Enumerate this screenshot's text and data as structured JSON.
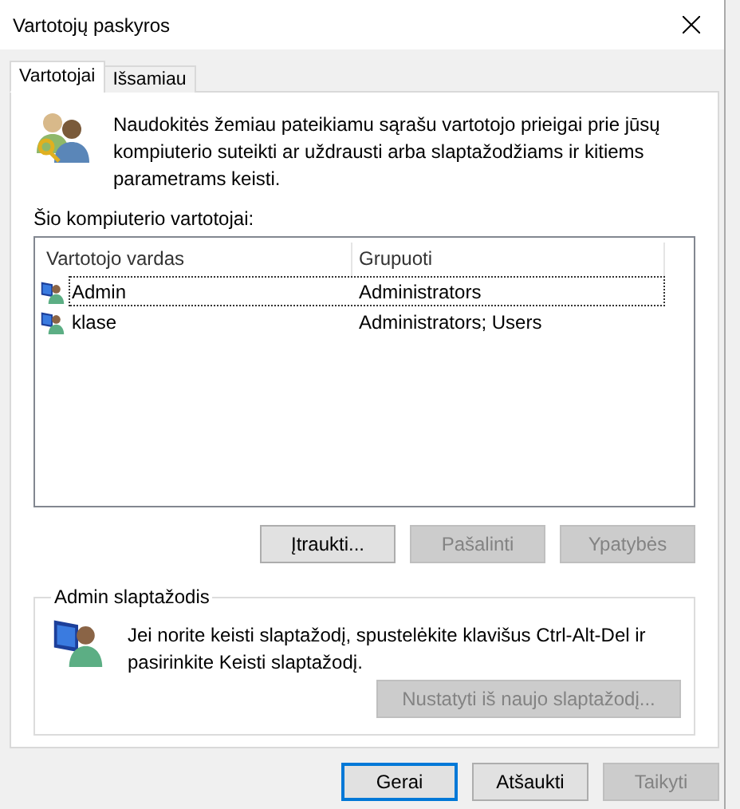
{
  "window": {
    "title": "Vartotojų paskyros"
  },
  "tabs": [
    {
      "label": "Vartotojai",
      "selected": true
    },
    {
      "label": "Išsamiau",
      "selected": false
    }
  ],
  "intro": "Naudokitės žemiau pateikiamu sąrašu vartotojo prieigai prie jūsų kompiuterio suteikti ar uždrausti arba slaptažodžiams ir kitiems parametrams keisti.",
  "users_label": "Šio kompiuterio vartotojai:",
  "table": {
    "columns": [
      "Vartotojo vardas",
      "Grupuoti"
    ],
    "rows": [
      {
        "name": "Admin",
        "group": "Administrators",
        "focused": true
      },
      {
        "name": "klase",
        "group": "Administrators; Users",
        "focused": false
      }
    ]
  },
  "list_buttons": [
    {
      "label": "Įtraukti...",
      "disabled": false
    },
    {
      "label": "Pašalinti",
      "disabled": true
    },
    {
      "label": "Ypatybės",
      "disabled": true
    }
  ],
  "password_group": {
    "title": "Admin slaptažodis",
    "text": "Jei norite keisti slaptažodį, spustelėkite klavišus Ctrl-Alt-Del ir pasirinkite Keisti slaptažodį.",
    "button": {
      "label": "Nustatyti iš naujo slaptažodį...",
      "disabled": true
    }
  },
  "dialog_buttons": [
    {
      "label": "Gerai",
      "disabled": false,
      "default": true
    },
    {
      "label": "Atšaukti",
      "disabled": false,
      "default": false
    },
    {
      "label": "Taikyti",
      "disabled": true,
      "default": false
    }
  ]
}
